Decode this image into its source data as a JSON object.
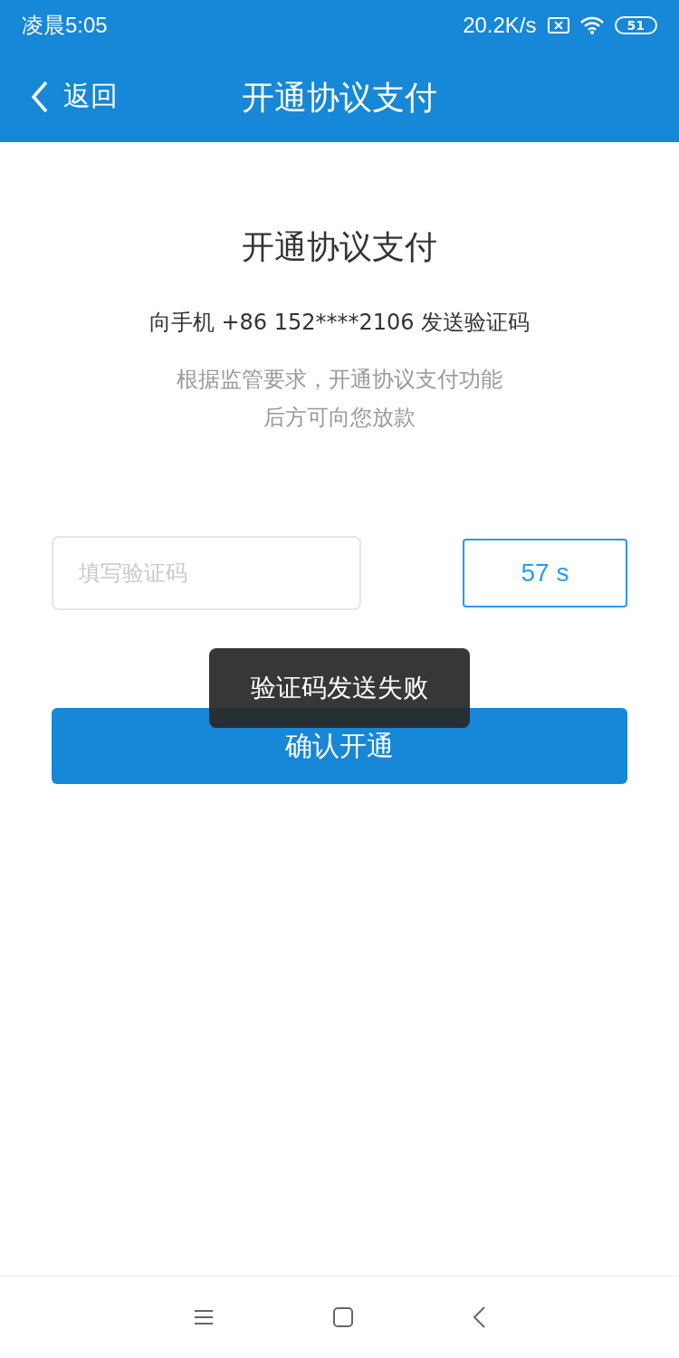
{
  "status_bar": {
    "time": "凌晨5:05",
    "speed": "20.2K/s",
    "battery": "51"
  },
  "nav_bar": {
    "back_label": "返回",
    "title": "开通协议支付"
  },
  "content": {
    "heading": "开通协议支付",
    "phone_line": "向手机 +86 152****2106 发送验证码",
    "note": "根据监管要求，开通协议支付功能后方可向您放款"
  },
  "code_field": {
    "placeholder": "填写验证码"
  },
  "countdown": "57 s",
  "confirm_button": "确认开通",
  "toast": "验证码发送失败"
}
